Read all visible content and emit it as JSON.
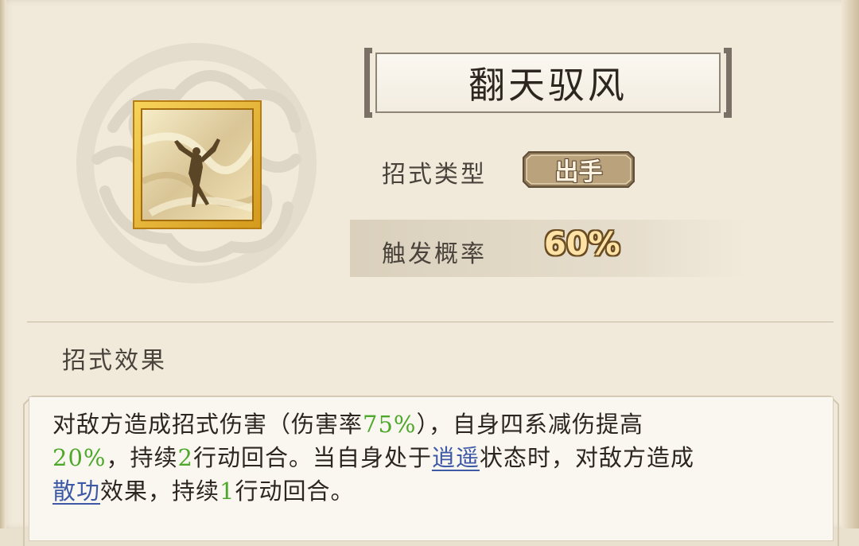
{
  "skill": {
    "name": "翻天驭风",
    "icon": "wind-dancer-icon"
  },
  "attributes": {
    "type_label": "招式类型",
    "type_value": "出手",
    "prob_label": "触发概率",
    "prob_value": "60%"
  },
  "effect": {
    "section_title": "招式效果",
    "line1_a": "对敌方造成招式伤害（伤害率",
    "line1_b": "75%",
    "line1_c": "），自身四系减伤提高",
    "line2_a": "20%",
    "line2_b": "，持续",
    "line2_c": "2",
    "line2_d": "行动回合。当自身处于",
    "line2_e": "逍遥",
    "line2_f": "状态时，对敌方造成",
    "line3_a": "散功",
    "line3_b": "效果，持续",
    "line3_c": "1",
    "line3_d": "行动回合。"
  },
  "colors": {
    "highlight_green": "#4ea82b",
    "link_blue": "#3e5aa6",
    "icon_frame_gold": "#e8b833"
  }
}
